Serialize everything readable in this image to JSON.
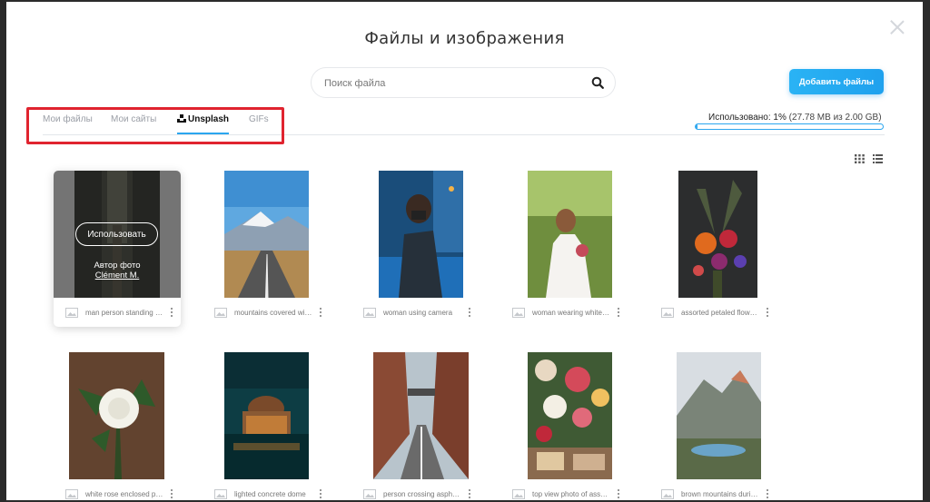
{
  "modal": {
    "title": "Файлы и изображения",
    "close_icon": "close-icon"
  },
  "search": {
    "placeholder": "Поиск файла",
    "value": "",
    "icon": "search-icon"
  },
  "add_button": {
    "label": "Добавить файлы"
  },
  "tabs": [
    {
      "label": "Мои файлы",
      "active": false
    },
    {
      "label": "Мои сайты",
      "active": false
    },
    {
      "label": "Unsplash",
      "active": true,
      "icon": "unsplash-logo-icon"
    },
    {
      "label": "GIFs",
      "active": false
    }
  ],
  "storage": {
    "label": "Использовано: 1%",
    "detail": "(27.78 MB из 2.00 GB)",
    "used_percent": 1
  },
  "view_toggle": {
    "grid_icon": "grid-view-icon",
    "list_icon": "list-view-icon"
  },
  "colors": {
    "accent": "#2ba6ef",
    "highlight": "#e0242f"
  },
  "hover_card": {
    "use_label": "Использовать",
    "author_label": "Автор фото",
    "author_name": "Clément M."
  },
  "images": [
    {
      "caption": "man person standing in forest",
      "icon": "image-icon"
    },
    {
      "caption": "mountains covered with snow",
      "icon": "image-icon"
    },
    {
      "caption": "woman using camera",
      "icon": "image-icon"
    },
    {
      "caption": "woman wearing white dress",
      "icon": "image-icon"
    },
    {
      "caption": "assorted petaled flowers",
      "icon": "image-icon"
    },
    {
      "caption": "white rose enclosed photo",
      "icon": "image-icon"
    },
    {
      "caption": "lighted concrete dome",
      "icon": "image-icon"
    },
    {
      "caption": "person crossing asphalt road",
      "icon": "image-icon"
    },
    {
      "caption": "top view photo of assorted flowers",
      "icon": "image-icon"
    },
    {
      "caption": "brown mountains during daytime",
      "icon": "image-icon"
    }
  ]
}
